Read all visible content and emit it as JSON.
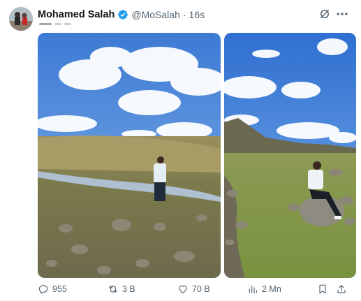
{
  "post": {
    "author_name": "Mohamed Salah",
    "handle": "@MoSalah",
    "separator": "·",
    "time": "16s"
  },
  "icons": {
    "verified": "verified-badge-icon",
    "grok": "grok-icon",
    "more": "more-options-icon"
  },
  "colors": {
    "verified": "#1d9bf0",
    "secondary_text": "#536471"
  },
  "actions": {
    "replies": "955",
    "reposts": "3 B",
    "likes": "70 B",
    "views": "2 Mn"
  }
}
